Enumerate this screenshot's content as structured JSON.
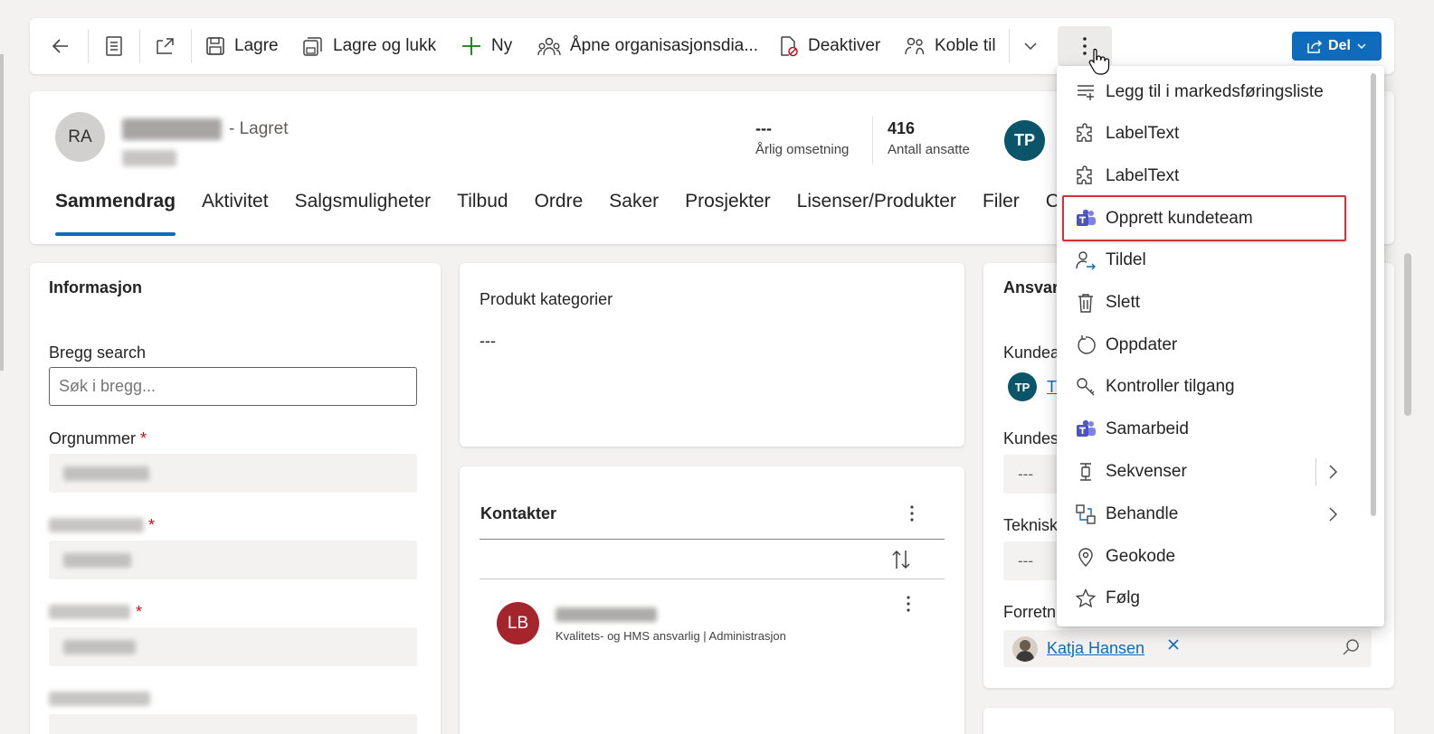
{
  "toolbar": {
    "save": "Lagre",
    "save_close": "Lagre og lukk",
    "new": "Ny",
    "org_chart": "Åpne organisasjonsdia...",
    "deactivate": "Deaktiver",
    "connect": "Koble til",
    "share": "Del"
  },
  "header": {
    "avatar_initials": "RA",
    "saved_status": "- Lagret",
    "kpi1_value": "---",
    "kpi1_label": "Årlig omsetning",
    "kpi2_value": "416",
    "kpi2_label": "Antall ansatte",
    "owner_initials": "TP"
  },
  "tabs": [
    "Sammendrag",
    "Aktivitet",
    "Salgsmuligheter",
    "Tilbud",
    "Ordre",
    "Saker",
    "Prosjekter",
    "Lisenser/Produkter",
    "Filer",
    "C"
  ],
  "info": {
    "title": "Informasjon",
    "bregg_label": "Bregg search",
    "bregg_placeholder": "Søk i bregg...",
    "orgnr_label": "Orgnummer",
    "required_mark": "*"
  },
  "product": {
    "title": "Produkt kategorier",
    "value": "---"
  },
  "contacts": {
    "title": "Kontakter",
    "contact_initials": "LB",
    "contact_subtitle": "Kvalitets- og HMS ansvarlig | Administrasjon"
  },
  "responsible": {
    "title": "Ansvar",
    "customer_label": "Kundea",
    "customer_initials": "TP",
    "customer_link": "T",
    "customer2_label": "Kundes",
    "customer2_value": "---",
    "tech_label": "Teknisk",
    "tech_value": "---",
    "business_label": "Forretn",
    "business_person": "Katja Hansen"
  },
  "menu": {
    "items": [
      "Legg til i markedsføringsliste",
      "LabelText",
      "LabelText",
      "Opprett kundeteam",
      "Tildel",
      "Slett",
      "Oppdater",
      "Kontroller tilgang",
      "Samarbeid",
      "Sekvenser",
      "Behandle",
      "Geokode",
      "Følg"
    ]
  },
  "colors": {
    "accent": "#0f6cbd",
    "highlight": "#d13438",
    "owner_avatar": "#0b556a",
    "contact_avatar": "#a4262c"
  }
}
